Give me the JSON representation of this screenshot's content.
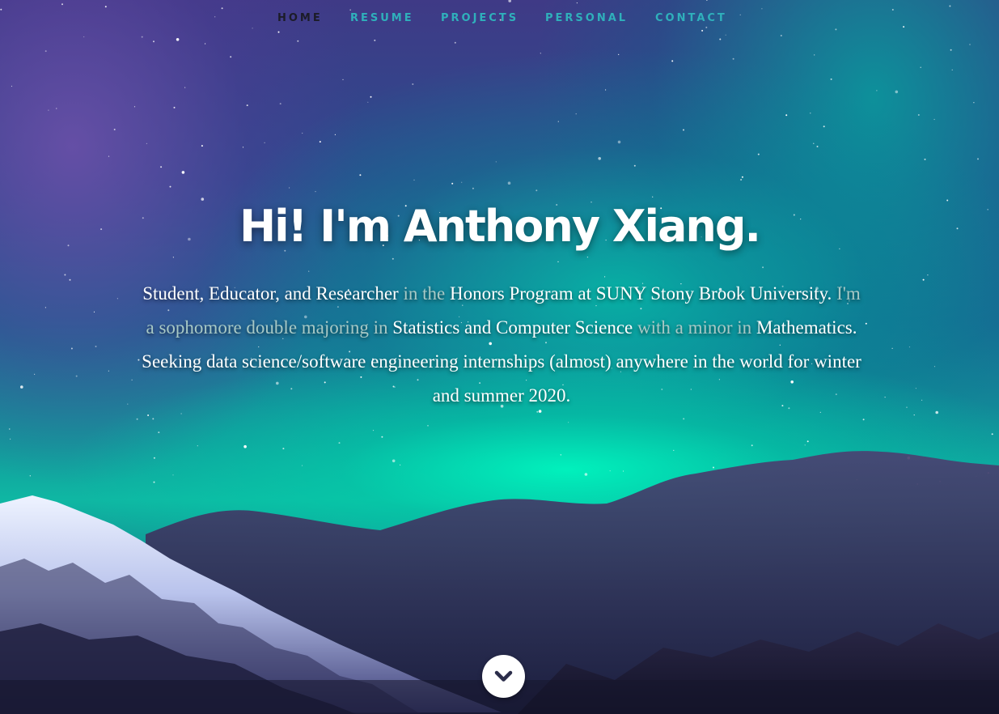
{
  "nav": {
    "items": [
      {
        "label": "HOME",
        "active": true
      },
      {
        "label": "RESUME",
        "active": false
      },
      {
        "label": "PROJECTS",
        "active": false
      },
      {
        "label": "PERSONAL",
        "active": false
      },
      {
        "label": "CONTACT",
        "active": false
      }
    ]
  },
  "hero": {
    "headline": "Hi! I'm Anthony Xiang.",
    "intro": {
      "p1": "Student, Educator, and Researcher",
      "p2": " in the ",
      "p3": "Honors Program at SUNY Stony Brook University.",
      "p4": " I'm a sophomore double majoring in ",
      "p5": "Statistics and Computer Science",
      "p6": " with a minor in ",
      "p7": "Mathematics.",
      "seeking": "Seeking data science/software engineering internships (almost) anywhere in the world for winter and summer 2020."
    },
    "scroll_icon": "chevron-down-icon"
  },
  "colors": {
    "nav_link": "#2fb0bb",
    "nav_active": "#1c1c28",
    "intro_dim": "#a8c9c6",
    "scroll_chevron": "#2b2d4a"
  }
}
